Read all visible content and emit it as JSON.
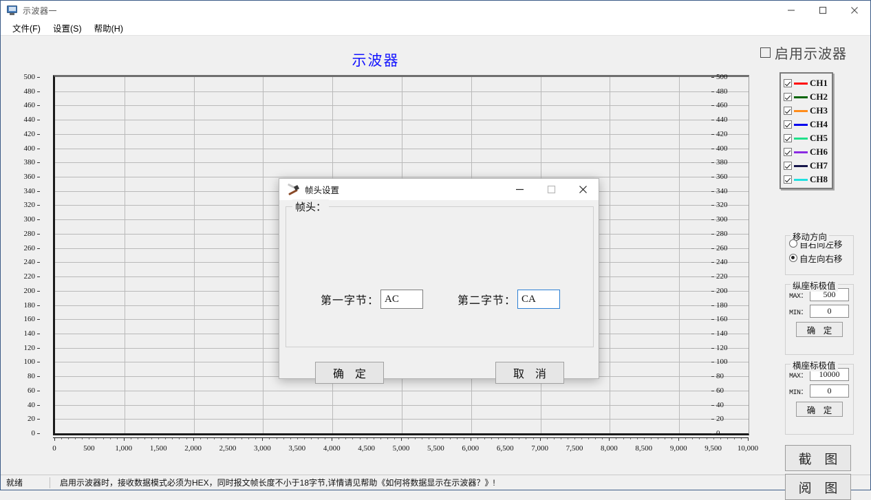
{
  "window": {
    "title": "示波器一",
    "icon": "monitor-icon",
    "controls": {
      "minimize": "minimize-icon",
      "maximize": "maximize-icon",
      "close": "close-icon"
    }
  },
  "menu": {
    "items": [
      {
        "label": "文件(F)"
      },
      {
        "label": "设置(S)"
      },
      {
        "label": "帮助(H)"
      }
    ]
  },
  "chart_data": {
    "type": "line",
    "title": "示波器",
    "title_color": "#1414ff",
    "xlabel": "",
    "ylabel": "",
    "xlim": [
      0,
      10000
    ],
    "ylim": [
      0,
      500
    ],
    "x_ticks": [
      0,
      500,
      1000,
      1500,
      2000,
      2500,
      3000,
      3500,
      4000,
      4500,
      5000,
      5500,
      6000,
      6500,
      7000,
      7500,
      8000,
      8500,
      9000,
      9500,
      10000
    ],
    "x_tick_labels": [
      "0",
      "500",
      "1,000",
      "1,500",
      "2,000",
      "2,500",
      "3,000",
      "3,500",
      "4,000",
      "4,500",
      "5,000",
      "5,500",
      "6,000",
      "6,500",
      "7,000",
      "7,500",
      "8,000",
      "8,500",
      "9,000",
      "9,500",
      "10,000"
    ],
    "y_ticks": [
      0,
      20,
      40,
      60,
      80,
      100,
      120,
      140,
      160,
      180,
      200,
      220,
      240,
      260,
      280,
      300,
      320,
      340,
      360,
      380,
      400,
      420,
      440,
      460,
      480,
      500
    ],
    "y_tick_labels": [
      "0",
      "20",
      "40",
      "60",
      "80",
      "100",
      "120",
      "140",
      "160",
      "180",
      "200",
      "220",
      "240",
      "260",
      "280",
      "300",
      "320",
      "340",
      "360",
      "380",
      "400",
      "420",
      "440",
      "460",
      "480",
      "500"
    ],
    "y_axis_both_sides": true,
    "grid": true,
    "grid_x_step": 1000,
    "grid_y_step": 20,
    "legend_position": "right",
    "series": [
      {
        "name": "CH1",
        "color": "#ff0000",
        "visible": true,
        "values": []
      },
      {
        "name": "CH2",
        "color": "#006400",
        "visible": true,
        "values": []
      },
      {
        "name": "CH3",
        "color": "#ff8c1a",
        "visible": true,
        "values": []
      },
      {
        "name": "CH4",
        "color": "#0000ee",
        "visible": true,
        "values": []
      },
      {
        "name": "CH5",
        "color": "#1fe08a",
        "visible": true,
        "values": []
      },
      {
        "name": "CH6",
        "color": "#8a2be2",
        "visible": true,
        "values": []
      },
      {
        "name": "CH7",
        "color": "#15154a",
        "visible": true,
        "visible_note": "",
        "values": []
      },
      {
        "name": "CH8",
        "color": "#1ee0e0",
        "visible": true,
        "values": []
      }
    ]
  },
  "right_panel": {
    "enable_checkbox": {
      "label": "启用示波器",
      "checked": false
    },
    "legend": {
      "channels": [
        {
          "label": "CH1",
          "color": "#ff0000",
          "checked": true
        },
        {
          "label": "CH2",
          "color": "#006400",
          "checked": true
        },
        {
          "label": "CH3",
          "color": "#ff8c1a",
          "checked": true
        },
        {
          "label": "CH4",
          "color": "#0000ee",
          "checked": true
        },
        {
          "label": "CH5",
          "color": "#1fe08a",
          "checked": true
        },
        {
          "label": "CH6",
          "color": "#8a2be2",
          "checked": true
        },
        {
          "label": "CH7",
          "color": "#15154a",
          "checked": true
        },
        {
          "label": "CH8",
          "color": "#1ee0e0",
          "checked": true
        }
      ]
    },
    "direction_group": {
      "title": "移动方向",
      "options": [
        {
          "label": "自右向左移",
          "selected": false
        },
        {
          "label": "自左向右移",
          "selected": true
        }
      ]
    },
    "vertical_group": {
      "title": "纵座标极值",
      "max_label": "MAX：",
      "max_value": "500",
      "min_label": "MIN：",
      "min_value": "0",
      "confirm_label": "确 定"
    },
    "horizontal_group": {
      "title": "横座标极值",
      "max_label": "MAX：",
      "max_value": "10000",
      "min_label": "MIN：",
      "min_value": "0",
      "confirm_label": "确 定"
    },
    "capture_button": "截 图",
    "view_button": "阅 图"
  },
  "dialog": {
    "title": "帧头设置",
    "icon": "tools-icon",
    "group_title": "帧头：",
    "first_byte": {
      "label": "第一字节：",
      "value": "AC",
      "focused": false
    },
    "second_byte": {
      "label": "第二字节：",
      "value": "CA",
      "focused": true
    },
    "ok_label": "确 定",
    "cancel_label": "取 消",
    "controls": {
      "minimize": "minimize-icon",
      "maximize": "maximize-icon-disabled",
      "close": "close-icon"
    }
  },
  "statusbar": {
    "ready": "就绪",
    "message": "启用示波器时，接收数据模式必须为HEX，同时报文帧长度不小于18字节,详情请见帮助《如何将数据显示在示波器？》!"
  }
}
